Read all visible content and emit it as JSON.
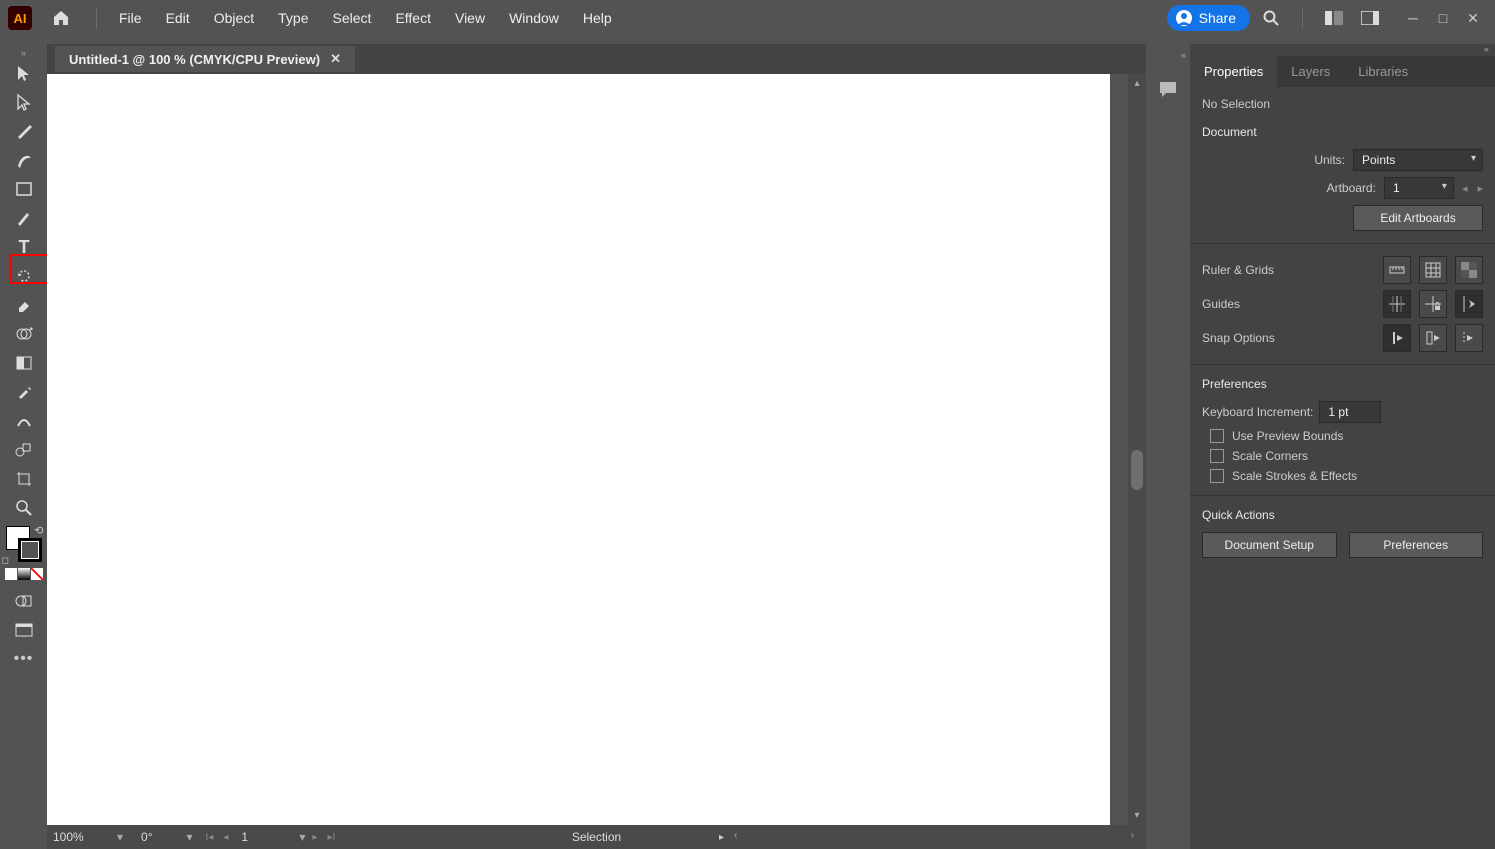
{
  "menubar": {
    "items": [
      "File",
      "Edit",
      "Object",
      "Type",
      "Select",
      "Effect",
      "View",
      "Window",
      "Help"
    ],
    "share": "Share"
  },
  "document": {
    "tab_title": "Untitled-1 @ 100 % (CMYK/CPU Preview)"
  },
  "statusbar": {
    "zoom": "100%",
    "rotation": "0°",
    "artboard": "1",
    "tool": "Selection"
  },
  "panels": {
    "tabs": [
      "Properties",
      "Layers",
      "Libraries"
    ],
    "no_selection": "No Selection",
    "document_section": "Document",
    "units_label": "Units:",
    "units_value": "Points",
    "artboard_label": "Artboard:",
    "artboard_value": "1",
    "edit_artboards": "Edit Artboards",
    "ruler_grids": "Ruler & Grids",
    "guides": "Guides",
    "snap_options": "Snap Options",
    "preferences_section": "Preferences",
    "kbd_inc_label": "Keyboard Increment:",
    "kbd_inc_value": "1 pt",
    "use_preview_bounds": "Use Preview Bounds",
    "scale_corners": "Scale Corners",
    "scale_strokes": "Scale Strokes & Effects",
    "quick_actions": "Quick Actions",
    "document_setup": "Document Setup",
    "preferences_btn": "Preferences"
  }
}
